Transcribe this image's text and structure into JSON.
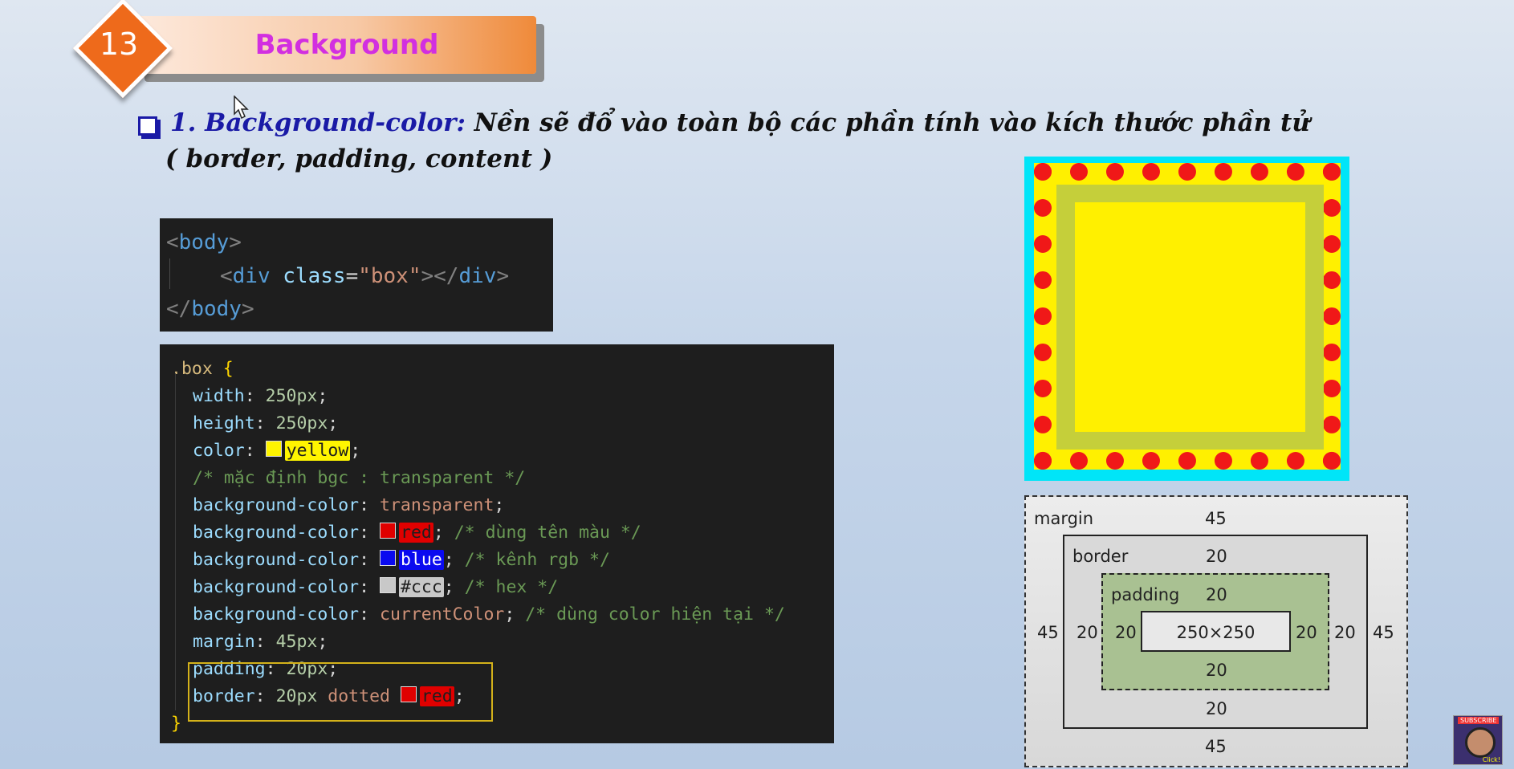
{
  "header": {
    "number": "13",
    "title": "Background"
  },
  "heading": {
    "label": "1. Background-color:",
    "text1": " Nền sẽ đổ vào toàn bộ các phần tính vào kích thước phần tử",
    "text2": "( border, padding, content )"
  },
  "html_code": {
    "body_open": "body",
    "div": "div",
    "class_attr": "class",
    "class_value": "\"box\"",
    "div_close": "div",
    "body_close": "body"
  },
  "css_code": {
    "selector": ".box",
    "lines": [
      {
        "prop": "width",
        "value": "250px"
      },
      {
        "prop": "height",
        "value": "250px"
      },
      {
        "prop": "color",
        "value": "yellow",
        "swatch": "#fff500"
      },
      {
        "comment": "/* mặc định bgc : transparent */"
      },
      {
        "prop": "background-color",
        "value": "transparent"
      },
      {
        "prop": "background-color",
        "value": "red",
        "swatch": "#e00000",
        "comment": "/* dùng tên màu */"
      },
      {
        "prop": "background-color",
        "value": "blue",
        "swatch": "#0a0af0",
        "comment": "/* kênh rgb */"
      },
      {
        "prop": "background-color",
        "value": "#ccc",
        "swatch": "#c8c8c8",
        "comment": "/* hex */"
      },
      {
        "prop": "background-color",
        "value": "currentColor",
        "comment": "/* dùng color hiện tại */"
      },
      {
        "prop": "margin",
        "value": "45px"
      },
      {
        "prop": "padding",
        "value": "20px"
      },
      {
        "prop": "border",
        "value1": "20px",
        "value2": "dotted",
        "value3": "red",
        "swatch": "#e00000"
      }
    ]
  },
  "box_model": {
    "margin_label": "margin",
    "border_label": "border",
    "padding_label": "padding",
    "content": "250×250",
    "margin": "45",
    "border": "20",
    "padding": "20"
  },
  "avatar": {
    "badge": "SUBSCRIBE",
    "click": "Click!"
  },
  "colors": {
    "accent": "#ee6a1b",
    "title": "#d22fe0",
    "heading_blue": "#1a1aa6",
    "dotted_border": "#f01818",
    "fill": "#fff000",
    "outer": "#00e5f8"
  }
}
